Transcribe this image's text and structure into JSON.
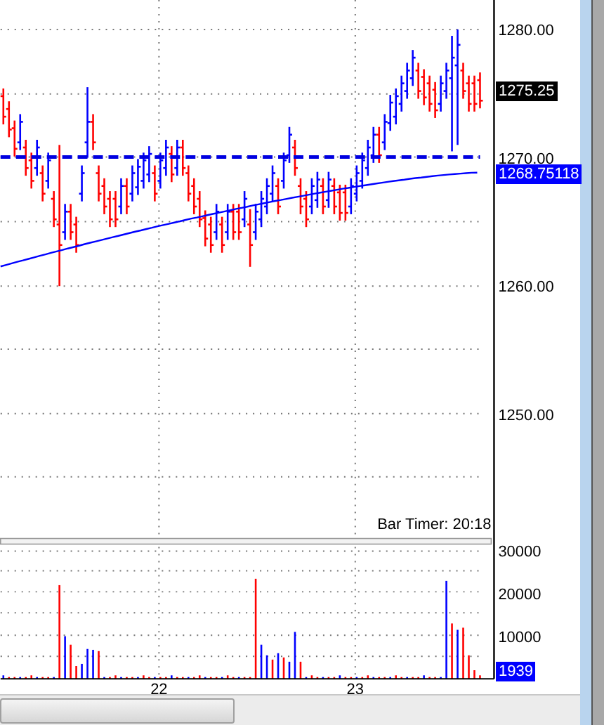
{
  "price_pane": {
    "axis_labels": [
      "1280.00",
      "1270.00",
      "1260.00",
      "1250.00"
    ],
    "last_price": "1275.25",
    "moving_average_value": "1268.75118",
    "bar_timer": "Bar Timer: 20:18"
  },
  "volume_pane": {
    "axis_labels": [
      "30000",
      "20000",
      "10000"
    ],
    "last_volume": "1939"
  },
  "x_axis": {
    "labels": [
      "22",
      "23"
    ]
  }
}
